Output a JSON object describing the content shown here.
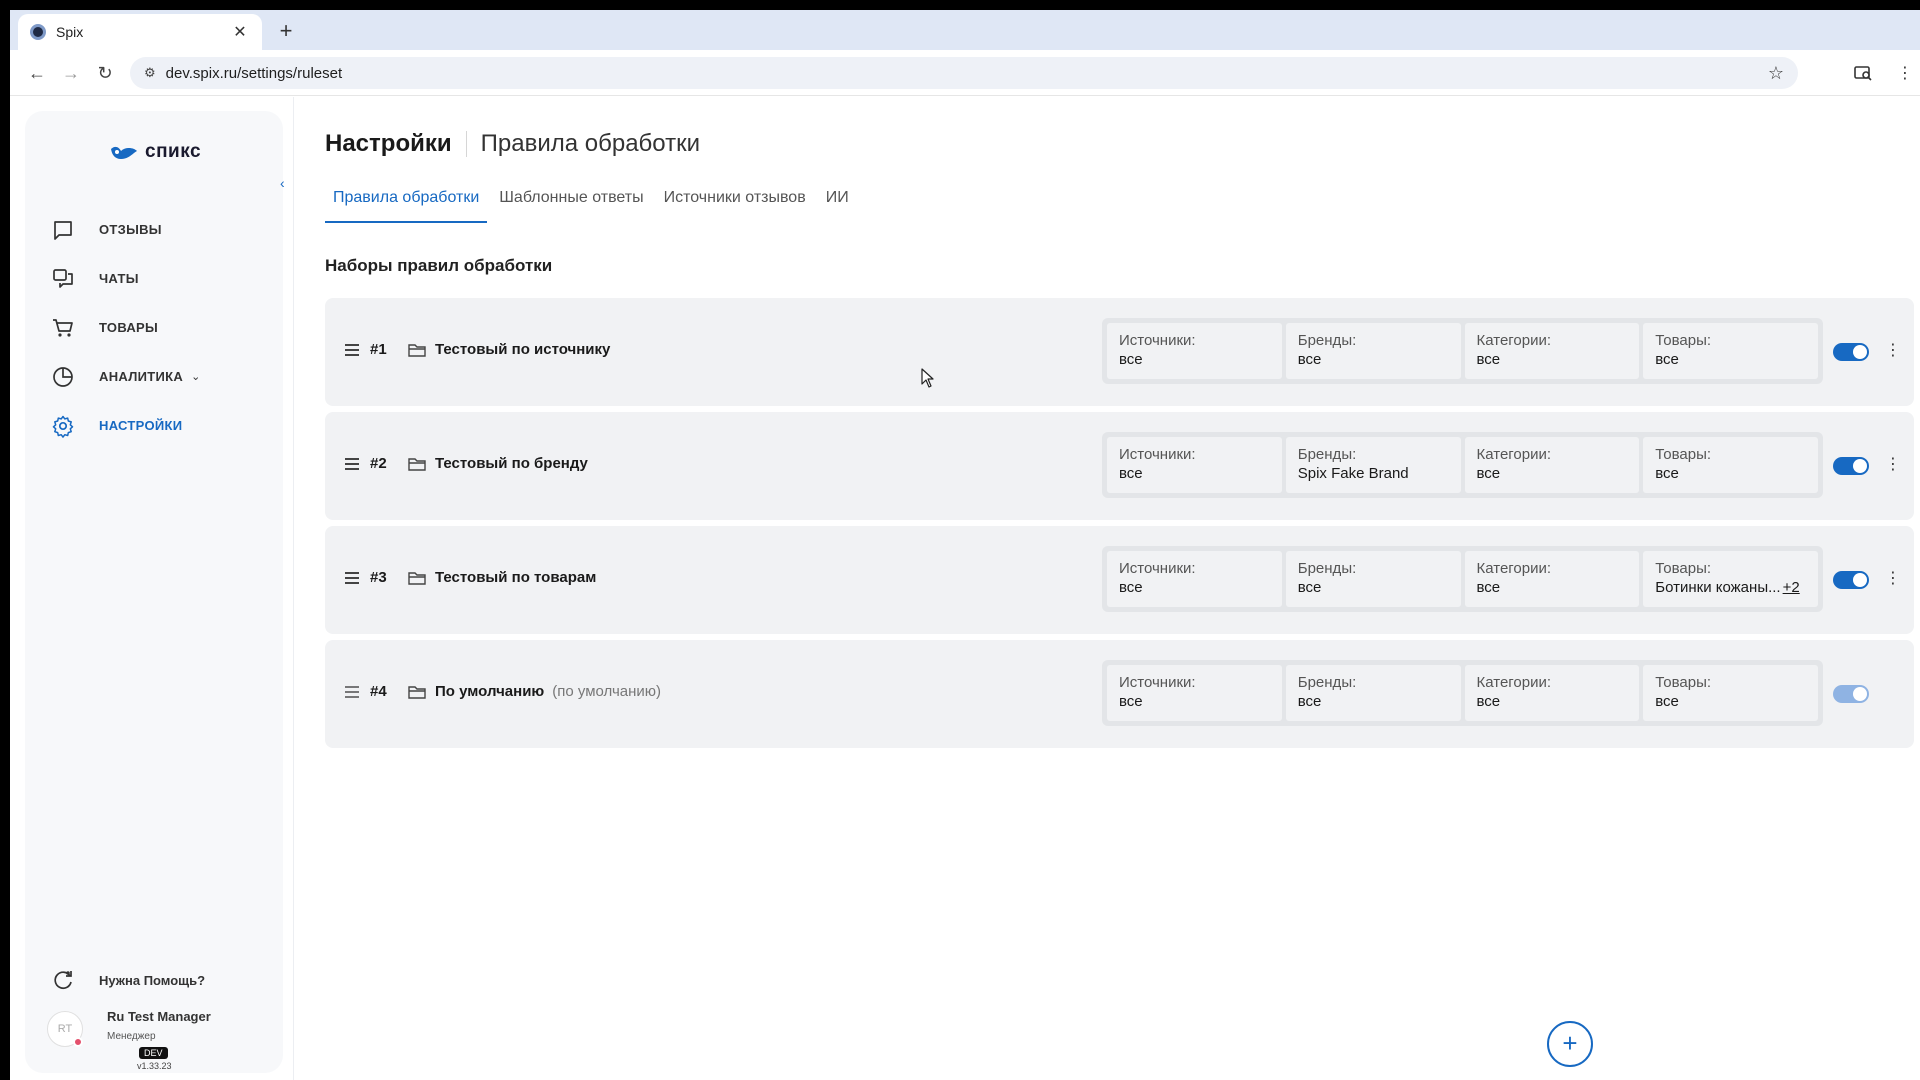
{
  "browser": {
    "tab_title": "Spix",
    "url": "dev.spix.ru/settings/ruleset"
  },
  "sidebar": {
    "logo_text": "спикс",
    "items": [
      {
        "label": "ОТЗЫВЫ",
        "icon": "message-square-icon"
      },
      {
        "label": "ЧАТЫ",
        "icon": "chats-icon"
      },
      {
        "label": "ТОВАРЫ",
        "icon": "cart-icon"
      },
      {
        "label": "АНАЛИТИКА",
        "icon": "pie-chart-icon"
      },
      {
        "label": "НАСТРОЙКИ",
        "icon": "gear-icon",
        "active": true
      }
    ],
    "help_label": "Нужна Помощь?",
    "user": {
      "initials": "RT",
      "name": "Ru Test Manager",
      "role": "Менеджер",
      "env_badge": "DEV",
      "version": "v1.33.23"
    }
  },
  "header": {
    "title": "Настройки",
    "subtitle": "Правила обработки"
  },
  "tabs": [
    "Правила обработки",
    "Шаблонные ответы",
    "Источники отзывов",
    "ИИ"
  ],
  "section_title": "Наборы правил обработки",
  "filter_labels": {
    "sources": "Источники:",
    "brands": "Бренды:",
    "categories": "Категории:",
    "products": "Товары:"
  },
  "rules": [
    {
      "num": "#1",
      "name": "Тестовый по источнику",
      "extra": "",
      "sources": "все",
      "brands": "все",
      "categories": "все",
      "products": "все",
      "products_more": "",
      "enabled": true
    },
    {
      "num": "#2",
      "name": "Тестовый по бренду",
      "extra": "",
      "sources": "все",
      "brands": "Spix Fake Brand",
      "categories": "все",
      "products": "все",
      "products_more": "",
      "enabled": true
    },
    {
      "num": "#3",
      "name": "Тестовый по товарам",
      "extra": "",
      "sources": "все",
      "brands": "все",
      "categories": "все",
      "products": "Ботинки кожаны...",
      "products_more": "+2",
      "enabled": true
    },
    {
      "num": "#4",
      "name": "По умолчанию",
      "extra": "(по умолчанию)",
      "sources": "все",
      "brands": "все",
      "categories": "все",
      "products": "все",
      "products_more": "",
      "enabled": true,
      "disabled": true
    }
  ],
  "colors": {
    "accent": "#1769c2",
    "rule_bg": "#f1f2f4"
  }
}
